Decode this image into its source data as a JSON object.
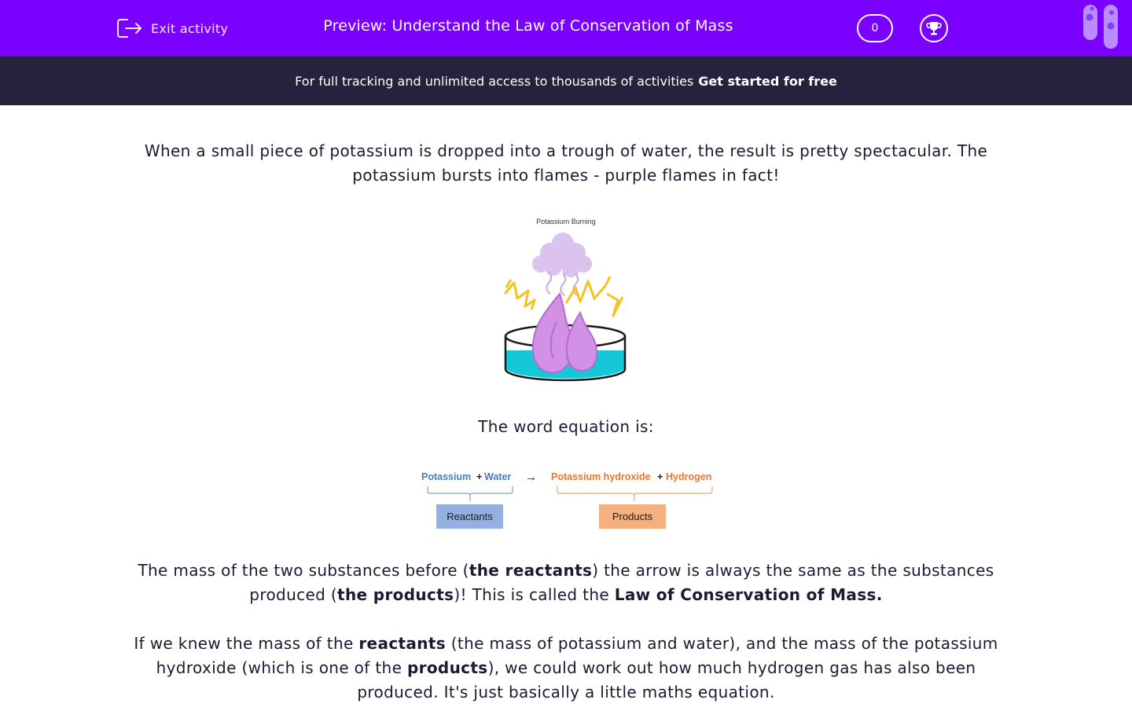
{
  "header": {
    "exit_label": "Exit activity",
    "title": "Preview: Understand the Law of Conservation of Mass",
    "score": "0",
    "colors": {
      "primary": "#7a00ff",
      "banner": "#26213c"
    }
  },
  "banner": {
    "text": "For full tracking and unlimited access to thousands of activities",
    "cta": "Get started for free"
  },
  "content": {
    "intro_line1": "When a small piece of potassium is dropped into a trough of water, the result is pretty spectacular. The",
    "intro_line2": "potassium bursts into flames - purple flames in fact!",
    "illustration_caption": "Potassium Burning",
    "word_equation_label": "The word equation is:",
    "equation": {
      "reactant1": "Potassium",
      "plus1": "+",
      "reactant2": "Water",
      "arrow": "→",
      "product1": "Potassium hydroxide",
      "plus2": "+",
      "product2": "Hydrogen",
      "reactants_label": "Reactants",
      "products_label": "Products",
      "reactant_color": "#4a7cc0",
      "product_color": "#e8772e"
    },
    "mass_para": {
      "p1": "The mass of the two substances before (",
      "b1": "the reactants",
      "p2": ") the arrow is always the same as the substances",
      "p3": "produced (",
      "b2": "the products",
      "p4": ")! This is called the ",
      "b3": "Law of Conservation of Mass."
    },
    "knew_para": {
      "p1": "If we knew the mass of the ",
      "b1": "reactants",
      "p2": " (the mass of potassium and water), and the mass of the potassium",
      "p3": "hydroxide (which is one of the ",
      "b2": "products",
      "p4": "), we could work out how much hydrogen gas has also been",
      "p5": "produced. It's just basically a little maths equation."
    }
  }
}
